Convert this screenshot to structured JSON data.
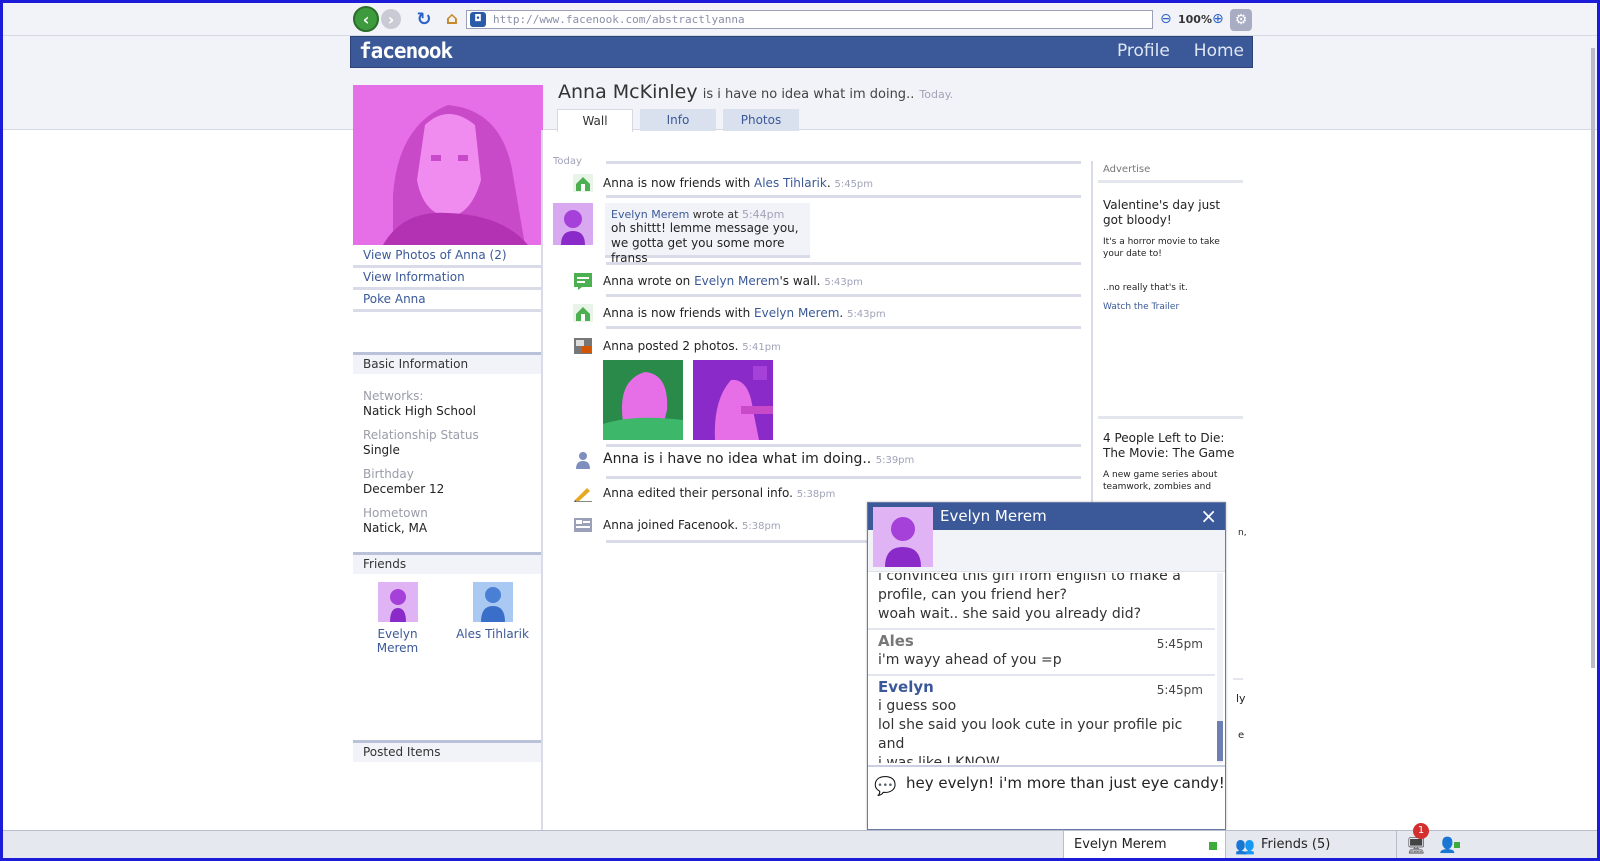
{
  "browser": {
    "url": "http://www.facenook.com/abstractlyanna",
    "zoom": "100%"
  },
  "header": {
    "logo": "facenook",
    "nav": [
      "Profile",
      "Home"
    ]
  },
  "profile": {
    "name": "Anna McKinley",
    "status": "is i have no idea what im doing..",
    "status_time": "Today.",
    "tabs": [
      "Wall",
      "Info",
      "Photos"
    ],
    "active_tab": "Wall"
  },
  "left": {
    "links": [
      "View Photos of Anna (2)",
      "View Information",
      "Poke Anna"
    ],
    "basic_info_head": "Basic Information",
    "info": [
      {
        "label": "Networks:",
        "value": "Natick High School"
      },
      {
        "label": "Relationship Status",
        "value": "Single"
      },
      {
        "label": "Birthday",
        "value": "December 12"
      },
      {
        "label": "Hometown",
        "value": "Natick, MA"
      }
    ],
    "friends_head": "Friends",
    "friends": [
      "Evelyn Merem",
      "Ales Tihlarik"
    ],
    "posted_head": "Posted Items"
  },
  "feed": {
    "date": "Today",
    "items": [
      {
        "pre": "Anna is now friends with ",
        "link": "Ales Tihlarik",
        "post": ".",
        "time": "5:45pm",
        "icon": "friends-icon"
      },
      {
        "pre": "Anna wrote on ",
        "link": "Evelyn Merem",
        "post": "'s wall.",
        "time": "5:43pm",
        "icon": "wall-post-icon"
      },
      {
        "pre": "Anna is now friends with ",
        "link": "Evelyn Merem",
        "post": ".",
        "time": "5:43pm",
        "icon": "friends-icon"
      },
      {
        "pre": "Anna posted 2 photos.",
        "link": "",
        "post": "",
        "time": "5:41pm",
        "icon": "photo-icon"
      },
      {
        "pre": "Anna is i have no idea what im doing..",
        "link": "",
        "post": "",
        "time": "5:39pm",
        "icon": "status-icon"
      },
      {
        "pre": "Anna edited their personal info.",
        "link": "",
        "post": "",
        "time": "5:38pm",
        "icon": "pencil-icon"
      },
      {
        "pre": "Anna joined Facenook.",
        "link": "",
        "post": "",
        "time": "5:38pm",
        "icon": "join-icon"
      }
    ],
    "wall_post": {
      "author": "Evelyn Merem",
      "wrote_at": "wrote at",
      "time": "5:44pm",
      "line1": "oh shittt! lemme message you,",
      "line2": "we gotta get you some more franss"
    }
  },
  "ads": {
    "head": "Advertise",
    "ad1_title": "Valentine's day just got bloody!",
    "ad1_text1": "It's a horror movie to take your date to!",
    "ad1_text2": "..no really that's it.",
    "ad1_link": "Watch the Trailer",
    "ad2_title": "4 People Left to Die: The Movie: The Game",
    "ad2_text": "A new game series about teamwork, zombies and",
    "ad2_frag1": "n,",
    "ad2_frag2": "ly",
    "ad2_frag3": "e"
  },
  "chat": {
    "name": "Evelyn Merem",
    "messages": [
      {
        "who": "",
        "time": "",
        "lines": [
          "i convinced this girl from english to make a",
          "profile, can you friend her?",
          "woah wait.. she said you already did?"
        ]
      },
      {
        "who": "Ales",
        "time": "5:45pm",
        "lines": [
          "i'm wayy ahead of you =p"
        ]
      },
      {
        "who": "Evelyn",
        "time": "5:45pm",
        "lines": [
          "i guess soo",
          "lol she said you look cute in your profile pic and",
          "i was like I KNOW"
        ]
      }
    ],
    "input_text": "hey evelyn! i'm more than just eye candy!"
  },
  "bottom_bar": {
    "chat_tab": "Evelyn Merem",
    "friends_label": "Friends (5)",
    "notification_count": "1"
  },
  "colors": {
    "fb_blue": "#3b5998",
    "profile_pink": "#e66ee6",
    "online_green": "#3daa3d"
  }
}
